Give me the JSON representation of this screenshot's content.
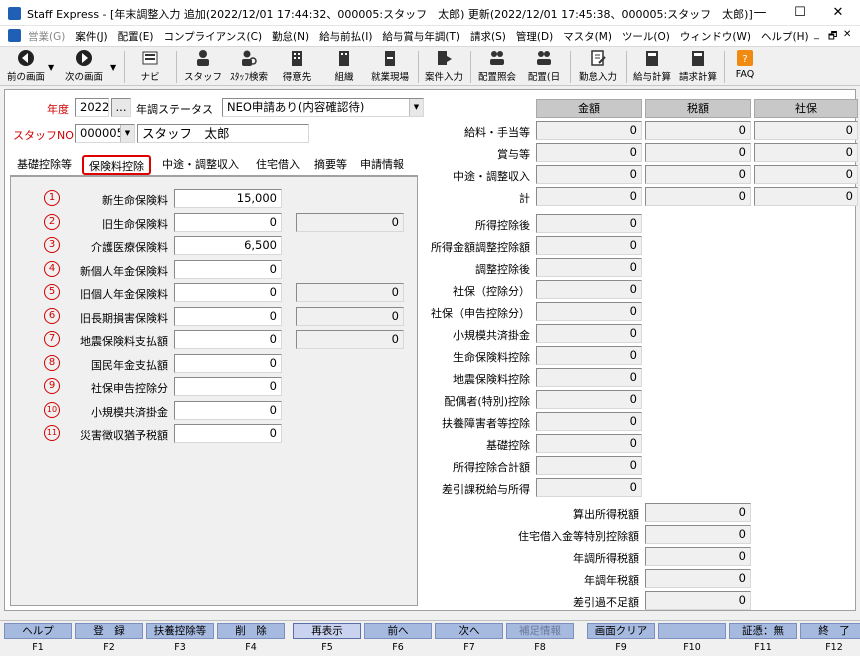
{
  "window": {
    "title": "Staff Express - [年末調整入力 追加(2022/12/01 17:44:32、000005:スタッフ　太郎) 更新(2022/12/01 17:45:38、000005:スタッフ　太郎)]",
    "minimize": "—",
    "maximize": "☐",
    "close": "✕"
  },
  "menu": {
    "items": [
      "営業(G)",
      "案件(J)",
      "配置(E)",
      "コンプライアンス(C)",
      "勤怠(N)",
      "給与前払(I)",
      "給与賞与年調(T)",
      "請求(S)",
      "管理(D)",
      "マスタ(M)",
      "ツール(O)",
      "ウィンドウ(W)",
      "ヘルプ(H)"
    ],
    "mdi_min": "_",
    "mdi_restore": "🗗",
    "mdi_close": "✕"
  },
  "toolbar": {
    "prev": "前の画面",
    "next": "次の画面",
    "navi": "ナビ",
    "staff": "スタッフ",
    "staff_search": "ｽﾀｯﾌ検索",
    "client": "得意先",
    "org": "組織",
    "site": "就業現場",
    "case_input": "案件入力",
    "assign_ref": "配置照会",
    "assign_day": "配置(日",
    "attendance": "勤怠入力",
    "payroll": "給与計算",
    "billing": "請求計算",
    "faq": "FAQ"
  },
  "header": {
    "year_label": "年度",
    "year_value": "2022",
    "year_btn": "...",
    "status_label": "年調ステータス",
    "status_value": "NEO申請あり(内容確認待)",
    "staff_label": "スタッフNO",
    "staff_no": "000005",
    "staff_name": "スタッフ　太郎"
  },
  "tabs": [
    "基礎控除等",
    "保険料控除",
    "中途・調整収入",
    "住宅借入",
    "摘要等",
    "申請情報"
  ],
  "insurance": {
    "rows": [
      {
        "num": "1",
        "label": "新生命保険料",
        "value": "15,000",
        "extra": ""
      },
      {
        "num": "2",
        "label": "旧生命保険料",
        "value": "0",
        "extra": "0"
      },
      {
        "num": "3",
        "label": "介護医療保険料",
        "value": "6,500",
        "extra": ""
      },
      {
        "num": "4",
        "label": "新個人年金保険料",
        "value": "0",
        "extra": ""
      },
      {
        "num": "5",
        "label": "旧個人年金保険料",
        "value": "0",
        "extra": "0"
      },
      {
        "num": "6",
        "label": "旧長期損害保険料",
        "value": "0",
        "extra": "0"
      },
      {
        "num": "7",
        "label": "地震保険料支払額",
        "value": "0",
        "extra": "0"
      },
      {
        "num": "8",
        "label": "国民年金支払額",
        "value": "0",
        "extra": ""
      },
      {
        "num": "9",
        "label": "社保申告控除分",
        "value": "0",
        "extra": ""
      },
      {
        "num": "10",
        "label": "小規模共済掛金",
        "value": "0",
        "extra": ""
      },
      {
        "num": "11",
        "label": "災害徴収猶予税額",
        "value": "0",
        "extra": ""
      }
    ]
  },
  "summary": {
    "col_headers": [
      "金額",
      "税額",
      "社保"
    ],
    "top_rows": [
      {
        "label": "給料・手当等",
        "amount": "0",
        "tax": "0",
        "social": "0"
      },
      {
        "label": "賞与等",
        "amount": "0",
        "tax": "0",
        "social": "0"
      },
      {
        "label": "中途・調整収入",
        "amount": "0",
        "tax": "0",
        "social": "0"
      },
      {
        "label": "計",
        "amount": "0",
        "tax": "0",
        "social": "0"
      }
    ],
    "deduction_rows": [
      {
        "label": "所得控除後",
        "value": "0"
      },
      {
        "label": "所得金額調整控除額",
        "value": "0"
      },
      {
        "label": "調整控除後",
        "value": "0"
      },
      {
        "label": "社保（控除分）",
        "value": "0"
      },
      {
        "label": "社保（申告控除分）",
        "value": "0"
      },
      {
        "label": "小規模共済掛金",
        "value": "0"
      },
      {
        "label": "生命保険料控除",
        "value": "0"
      },
      {
        "label": "地震保険料控除",
        "value": "0"
      },
      {
        "label": "配偶者(特別)控除",
        "value": "0"
      },
      {
        "label": "扶養障害者等控除",
        "value": "0"
      },
      {
        "label": "基礎控除",
        "value": "0"
      },
      {
        "label": "所得控除合計額",
        "value": "0"
      },
      {
        "label": "差引課税給与所得",
        "value": "0"
      }
    ],
    "tax_rows": [
      {
        "label": "算出所得税額",
        "value": "0"
      },
      {
        "label": "住宅借入金等特別控除額",
        "value": "0"
      },
      {
        "label": "年調所得税額",
        "value": "0"
      },
      {
        "label": "年調年税額",
        "value": "0"
      },
      {
        "label": "差引過不足額",
        "value": "0"
      }
    ]
  },
  "fkeys": [
    {
      "label": "ヘルプ",
      "key": "F1"
    },
    {
      "label": "登　録",
      "key": "F2"
    },
    {
      "label": "扶養控除等",
      "key": "F3"
    },
    {
      "label": "削　除",
      "key": "F4"
    },
    {
      "label": "再表示",
      "key": "F5"
    },
    {
      "label": "前へ",
      "key": "F6"
    },
    {
      "label": "次へ",
      "key": "F7"
    },
    {
      "label": "補足情報",
      "key": "F8"
    },
    {
      "label": "画面クリア",
      "key": "F9"
    },
    {
      "label": "",
      "key": "F10"
    },
    {
      "label": "証憑：無",
      "key": "F11"
    },
    {
      "label": "終　了",
      "key": "F12"
    }
  ]
}
